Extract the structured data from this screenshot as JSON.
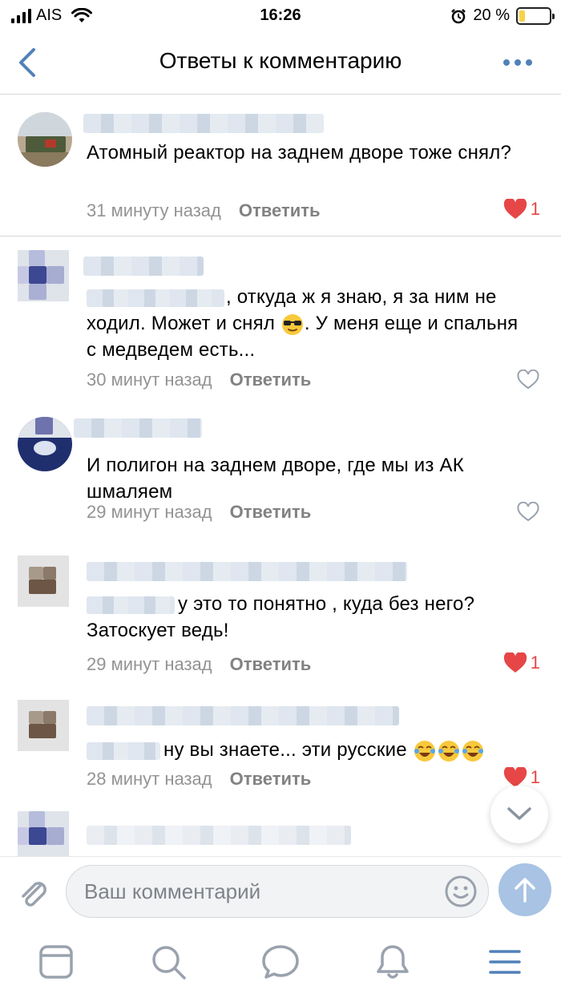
{
  "status_bar": {
    "carrier": "AIS",
    "time": "16:26",
    "battery_text": "20 %",
    "battery_level": 0.2
  },
  "nav": {
    "title": "Ответы к комментарию"
  },
  "comments": [
    {
      "text": "Атомный реактор на заднем дворе тоже снял?",
      "time": "31 минуту назад",
      "reply_label": "Ответить",
      "liked": true,
      "likes": "1"
    },
    {
      "text": ", откуда ж я знаю, я за ним не ходил. Может и снял",
      "text_after_emoji": ". У меня еще и спальня с медведем есть...",
      "emoji": "sunglasses-face",
      "time": "30 минут назад",
      "reply_label": "Ответить",
      "liked": false
    },
    {
      "text": "И полигон на заднем дворе, где мы из АК шмаляем",
      "time": "29 минут назад",
      "reply_label": "Ответить",
      "liked": false
    },
    {
      "text": "у это то понятно , куда без него? Затоскует ведь!",
      "time": "29 минут назад",
      "reply_label": "Ответить",
      "liked": true,
      "likes": "1"
    },
    {
      "text": "ну вы знаете... эти русские",
      "emoji": "crying-laughing-face",
      "time": "28 минут назад",
      "reply_label": "Ответить",
      "liked": true,
      "likes": "1"
    }
  ],
  "composer": {
    "placeholder": "Ваш комментарий"
  },
  "colors": {
    "accent": "#5181b8",
    "like": "#e64646",
    "meta": "#939393",
    "send_button": "#a8c3e4"
  },
  "tabbar": {
    "items": [
      "news-icon",
      "search-icon",
      "messages-icon",
      "notifications-icon",
      "menu-icon"
    ],
    "active": "menu-icon"
  }
}
